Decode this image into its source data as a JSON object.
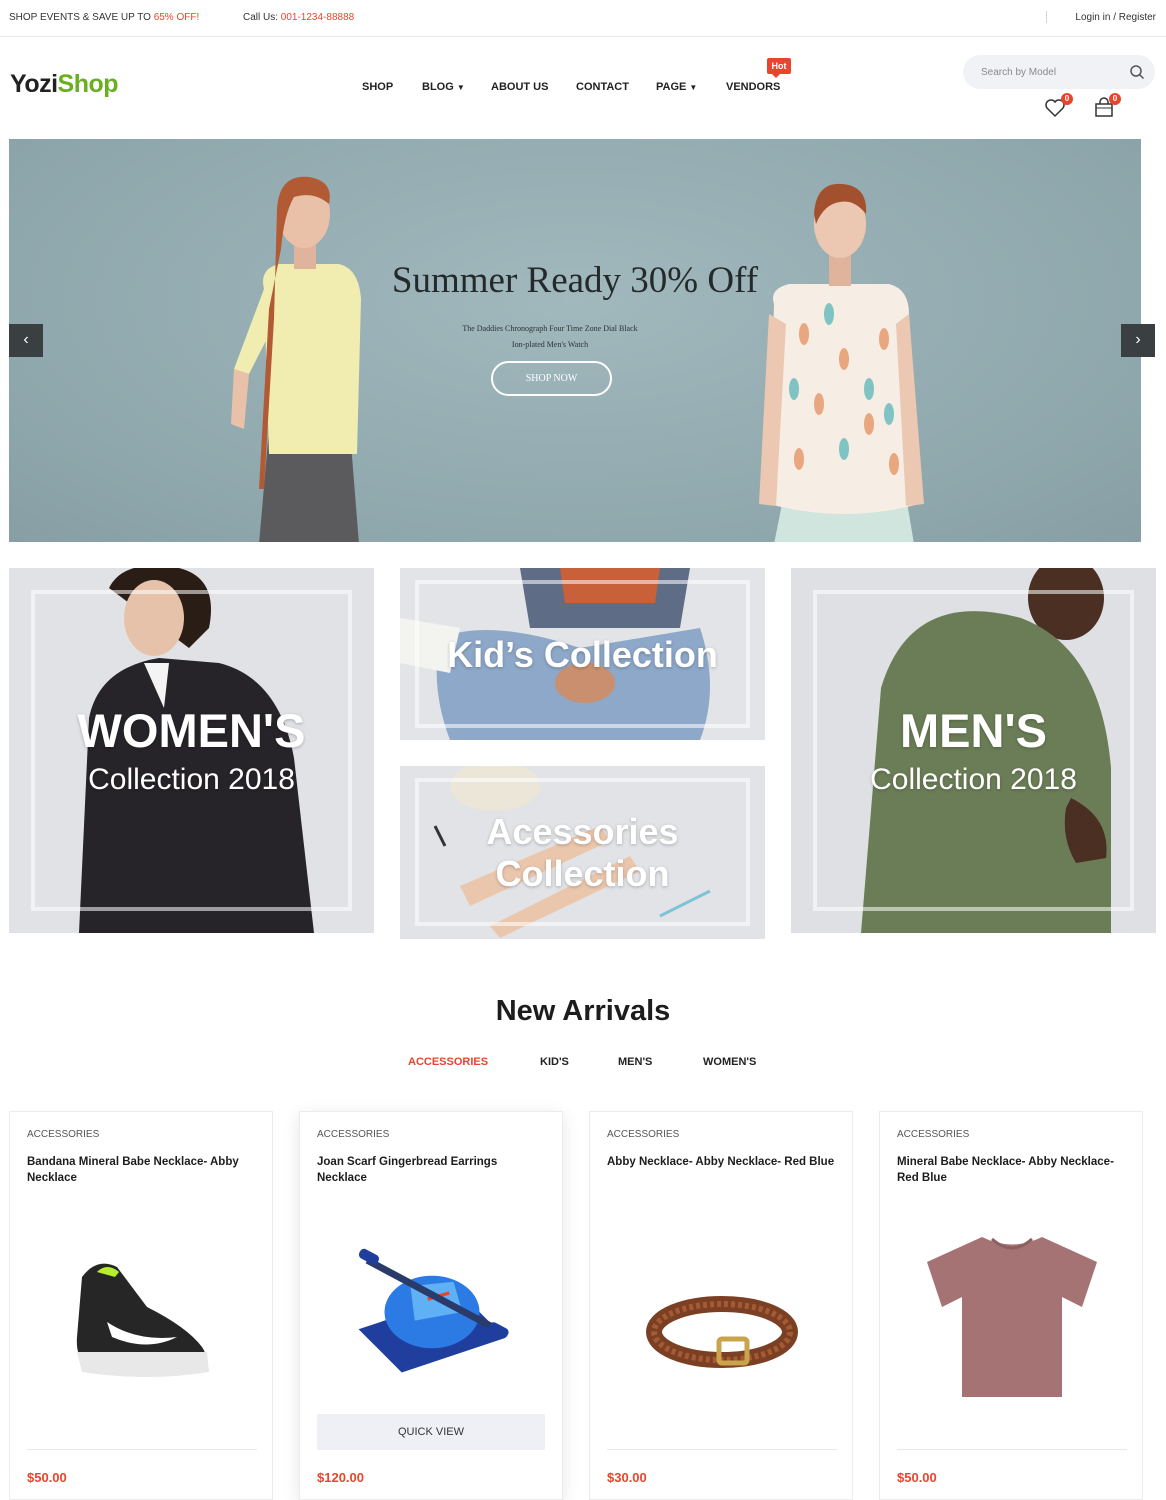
{
  "topbar": {
    "promo_prefix": "SHOP EVENTS & SAVE UP TO ",
    "promo_highlight": "65% OFF!",
    "call_prefix": "Call Us: ",
    "call_number": "001-1234-88888",
    "login": "Login in / Register"
  },
  "header": {
    "logo_part1": "Yozi",
    "logo_part2": "Shop",
    "nav": [
      "SHOP",
      "BLOG",
      "ABOUT US",
      "CONTACT",
      "PAGE",
      "VENDORS"
    ],
    "hot_badge": "Hot",
    "search_placeholder": "Search by Model",
    "wishlist_count": "0",
    "cart_count": "0"
  },
  "hero": {
    "title": "Summer Ready 30% Off",
    "subtitle_line1": "The Daddies Chronograph Four Time Zone Dial Black",
    "subtitle_line2": "Ion-plated Men's Watch",
    "button": "SHOP NOW",
    "prev_label": "‹",
    "next_label": "›"
  },
  "collections": {
    "women_big": "WOMEN'S",
    "women_small": "Collection 2018",
    "kids": "Kid’s Collection",
    "accessories_line1": "Acessories",
    "accessories_line2": "Collection",
    "men_big": "MEN'S",
    "men_small": "Collection 2018"
  },
  "arrivals": {
    "title": "New Arrivals",
    "tabs": [
      "ACCESSORIES",
      "KID'S",
      "MEN'S",
      "WOMEN'S"
    ],
    "quick_view": "QUICK VIEW",
    "products": [
      {
        "category": "ACCESSORIES",
        "name": "Bandana Mineral Babe Necklace- Abby Necklace",
        "price": "$50.00",
        "icon": "sneaker-icon"
      },
      {
        "category": "ACCESSORIES",
        "name": "Joan Scarf Gingerbread Earrings Necklace",
        "price": "$120.00",
        "icon": "ab-roller-icon"
      },
      {
        "category": "ACCESSORIES",
        "name": "Abby Necklace- Abby Necklace- Red Blue",
        "price": "$30.00",
        "icon": "belt-icon"
      },
      {
        "category": "ACCESSORIES",
        "name": "Mineral Babe Necklace- Abby Necklace- Red Blue",
        "price": "$50.00",
        "icon": "tshirt-icon"
      }
    ]
  },
  "colors": {
    "accent": "#e8452c",
    "brand_green": "#6aaf1e",
    "hero_bg": "#93acb1"
  }
}
